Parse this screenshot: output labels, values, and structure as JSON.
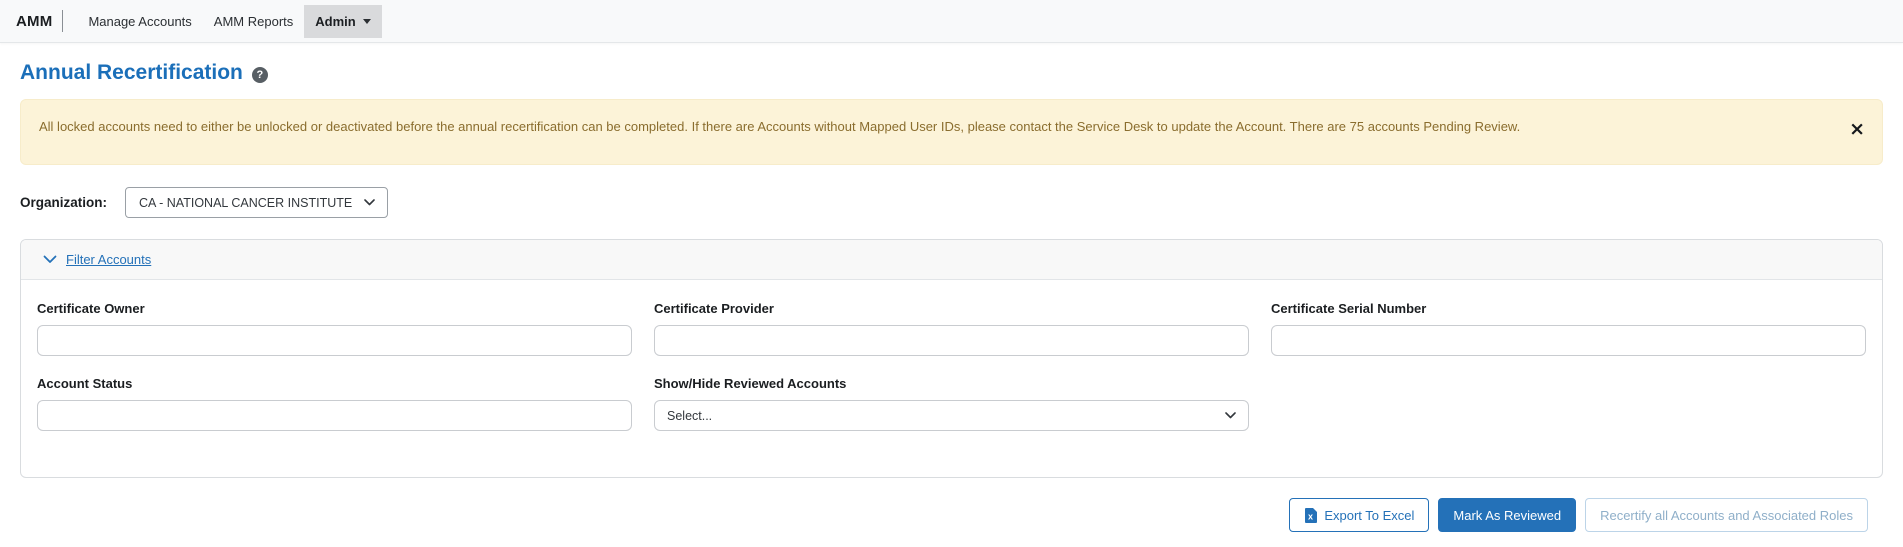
{
  "navbar": {
    "brand": "AMM",
    "items": [
      {
        "label": "Manage Accounts"
      },
      {
        "label": "AMM Reports"
      },
      {
        "label": "Admin"
      }
    ]
  },
  "page": {
    "title": "Annual Recertification",
    "help_icon_glyph": "?"
  },
  "alert": {
    "message": "All locked accounts need to either be unlocked or deactivated before the annual recertification can be completed. If there are Accounts without Mapped User IDs, please contact the Service Desk to update the Account. There are 75 accounts Pending Review.",
    "close_glyph": "×"
  },
  "organization": {
    "label": "Organization:",
    "selected": "CA - NATIONAL CANCER INSTITUTE"
  },
  "filter": {
    "title": "Filter Accounts",
    "fields": {
      "certificate_owner": {
        "label": "Certificate Owner",
        "value": ""
      },
      "certificate_provider": {
        "label": "Certificate Provider",
        "value": ""
      },
      "certificate_serial_number": {
        "label": "Certificate Serial Number",
        "value": ""
      },
      "account_status": {
        "label": "Account Status",
        "value": ""
      },
      "show_hide_reviewed": {
        "label": "Show/Hide Reviewed Accounts",
        "selected": "Select..."
      }
    }
  },
  "actions": {
    "export_to_excel": "Export To Excel",
    "mark_as_reviewed": "Mark As Reviewed",
    "recertify_all": "Recertify all Accounts and Associated Roles"
  },
  "colors": {
    "accent_blue": "#2471b8",
    "navbar_bg": "#f8f9fa",
    "admin_active_bg": "#d9dadc",
    "alert_bg": "#fcf3d8",
    "alert_text": "#8a6d2e",
    "disabled_button_border": "#bcd4e8",
    "disabled_button_text": "#8fafc9"
  }
}
